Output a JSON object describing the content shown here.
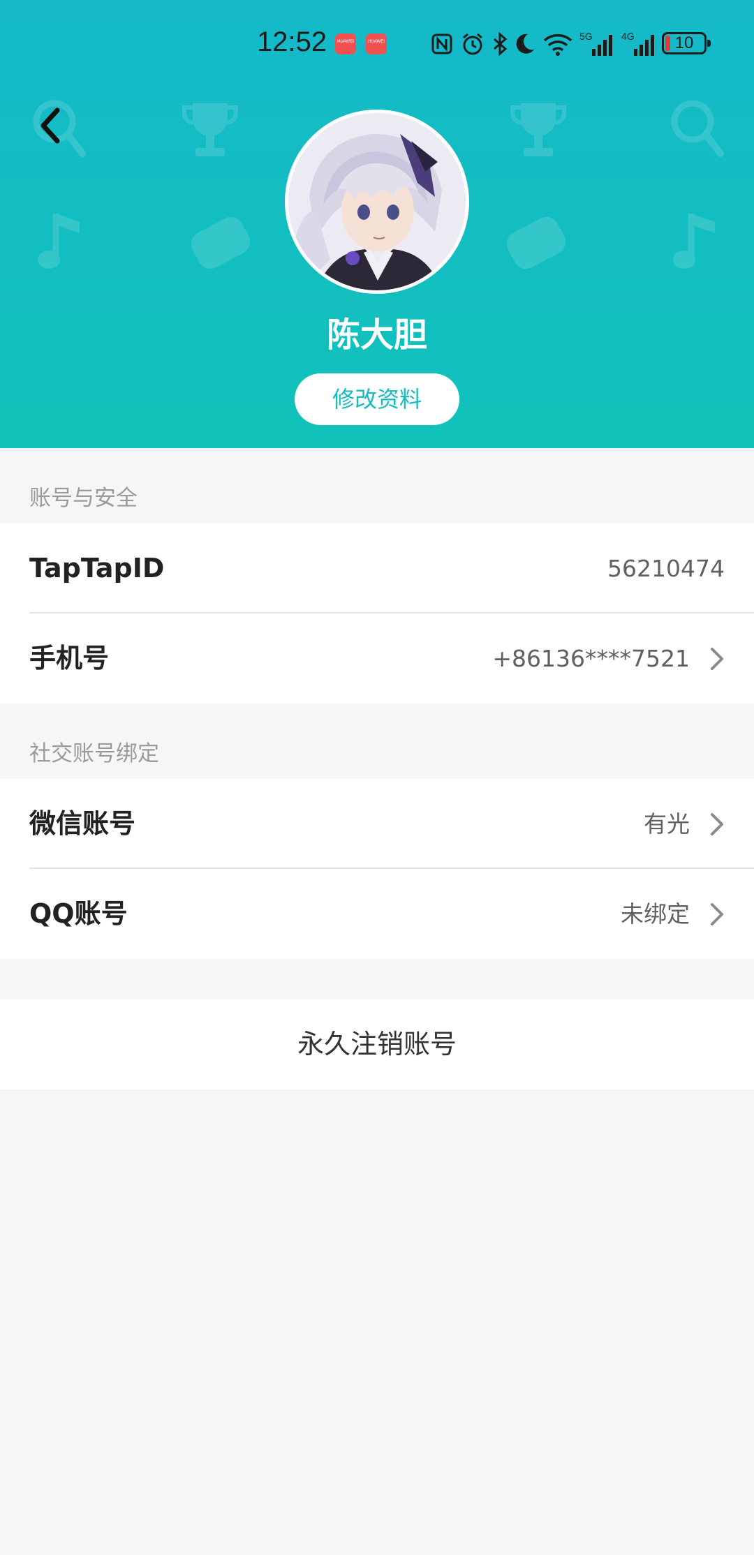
{
  "status_bar": {
    "time": "12:52",
    "notif_icon_label": "HUAWEI",
    "battery": "10",
    "icons": [
      "nfc-icon",
      "alarm-icon",
      "bluetooth-icon",
      "moon-icon",
      "wifi-icon",
      "signal-5g-icon",
      "signal-4g-icon",
      "battery-icon"
    ]
  },
  "profile": {
    "name": "陈大胆",
    "edit_button": "修改资料"
  },
  "section_account": {
    "title": "账号与安全",
    "rows": [
      {
        "label": "TapTapID",
        "value": "56210474"
      },
      {
        "label": "手机号",
        "value": "+86136****7521"
      }
    ]
  },
  "section_social": {
    "title": "社交账号绑定",
    "rows": [
      {
        "label": "微信账号",
        "value": "有光"
      },
      {
        "label": "QQ账号",
        "value": "未绑定"
      }
    ]
  },
  "delete_account": "永久注销账号",
  "colors": {
    "header_top": "#15b9c9",
    "header_bottom": "#10c2b9",
    "accent": "#15bcc0",
    "background": "#f5f6f8"
  }
}
